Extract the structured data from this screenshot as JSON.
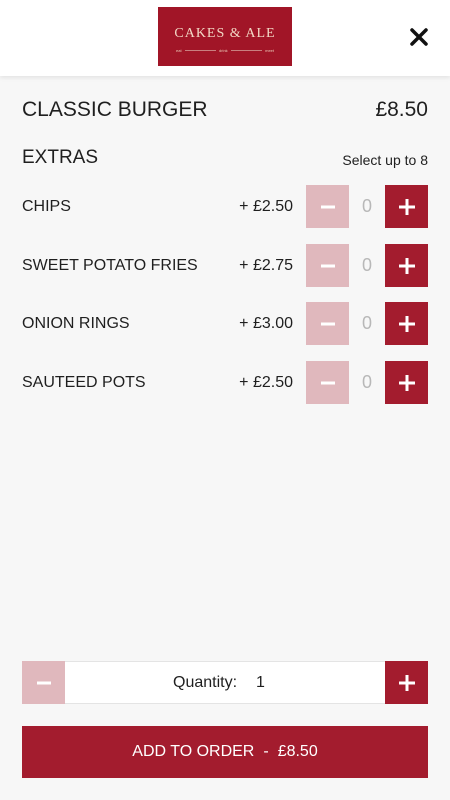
{
  "header": {
    "logo_text": "CAKES & ALE",
    "logo_tagline": [
      "eat",
      "drink",
      "meet"
    ],
    "close_icon": "close-icon"
  },
  "item": {
    "name": "CLASSIC BURGER",
    "price": "£8.50"
  },
  "extras": {
    "title": "EXTRAS",
    "note": "Select up to 8",
    "items": [
      {
        "name": "CHIPS",
        "price": "+ £2.50",
        "count": "0"
      },
      {
        "name": "SWEET POTATO FRIES",
        "price": "+ £2.75",
        "count": "0"
      },
      {
        "name": "ONION RINGS",
        "price": "+ £3.00",
        "count": "0"
      },
      {
        "name": "SAUTEED POTS",
        "price": "+ £2.50",
        "count": "0"
      }
    ],
    "minus_label": "-",
    "plus_icon": "plus-icon"
  },
  "quantity": {
    "label": "Quantity:",
    "value": "1",
    "minus_label": "-"
  },
  "add_to_order": {
    "label": "ADD TO ORDER",
    "separator": "-",
    "total": "£8.50"
  },
  "colors": {
    "brand": "#a31c2e",
    "brand_light": "#e0b8bd",
    "logo_bg": "#a11527",
    "muted_text": "#b8b8b8"
  }
}
